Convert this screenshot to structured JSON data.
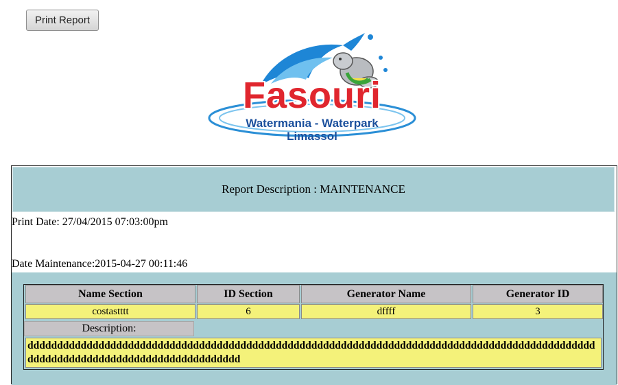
{
  "toolbar": {
    "print_label": "Print Report"
  },
  "logo": {
    "title": "Fasouri",
    "subtitle_line1": "Watermania - Waterpark",
    "subtitle_line2": "Limassol"
  },
  "report": {
    "description": "Report Description : MAINTENANCE",
    "print_date": "Print Date: 27/04/2015 07:03:00pm",
    "date_maintenance": "Date Maintenance:2015-04-27 00:11:46",
    "table": {
      "headers": [
        "Name Section",
        "ID Section",
        "Generator Name",
        "Generator ID"
      ],
      "row": [
        "costastttt",
        "6",
        "dffff",
        "3"
      ],
      "description_label": "Description:",
      "description_text": "dddddddddddddddddddddddddddddddddddddddddddddddddddddddddddddddddddddddddddddddddddddddddddddddddddddddddddddddddddddddddddddddddddd"
    }
  },
  "colors": {
    "band": "#a7cdd3",
    "header_cell": "#c6c3c6",
    "value_cell": "#f4f27a",
    "logo_red": "#e0262e",
    "logo_blue": "#1a4f9c"
  }
}
